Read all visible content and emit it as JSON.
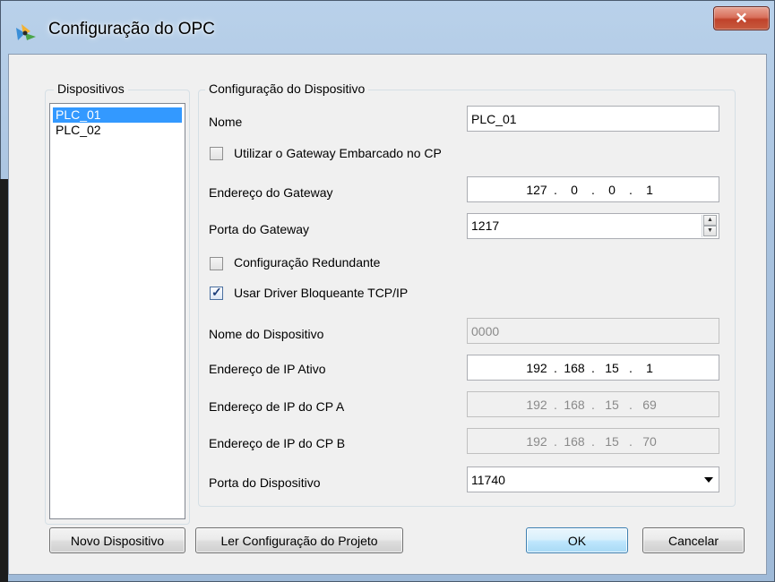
{
  "window": {
    "title": "Configuração do OPC",
    "close_glyph": "✕"
  },
  "devices_group": {
    "label": "Dispositivos",
    "items": [
      "PLC_01",
      "PLC_02"
    ],
    "selected_index": 0
  },
  "config_group": {
    "label": "Configuração do Dispositivo",
    "name_label": "Nome",
    "name_value": "PLC_01",
    "embedded_gateway_label": "Utilizar o Gateway Embarcado no CP",
    "embedded_gateway_checked": false,
    "gateway_address_label": "Endereço do Gateway",
    "gateway_address": [
      "127",
      "0",
      "0",
      "1"
    ],
    "gateway_port_label": "Porta do Gateway",
    "gateway_port_value": "1217",
    "redundant_label": "Configuração Redundante",
    "redundant_checked": false,
    "blocking_driver_label": "Usar Driver Bloqueante TCP/IP",
    "blocking_driver_checked": true,
    "device_name_label": "Nome do Dispositivo",
    "device_name_value": "0000",
    "active_ip_label": "Endereço de IP Ativo",
    "active_ip": [
      "192",
      "168",
      "15",
      "1"
    ],
    "cp_a_ip_label": "Endereço de IP do CP A",
    "cp_a_ip": [
      "192",
      "168",
      "15",
      "69"
    ],
    "cp_b_ip_label": "Endereço de IP do CP B",
    "cp_b_ip": [
      "192",
      "168",
      "15",
      "70"
    ],
    "device_port_label": "Porta do Dispositivo",
    "device_port_value": "11740"
  },
  "buttons": {
    "new_device": "Novo Dispositivo",
    "read_project_config": "Ler Configuração do Projeto",
    "ok": "OK",
    "cancel": "Cancelar"
  },
  "colors": {
    "selection": "#3399ff",
    "dialog_bg": "#f0f0f0",
    "title_gradient": "#b9d1ea",
    "close_button": "#c7432b"
  },
  "icons": {
    "title_icon": "opc-app-icon",
    "close": "close-icon",
    "spin": "spinner-arrows-icon",
    "dropdown": "chevron-down-icon",
    "check": "checkmark-icon"
  }
}
